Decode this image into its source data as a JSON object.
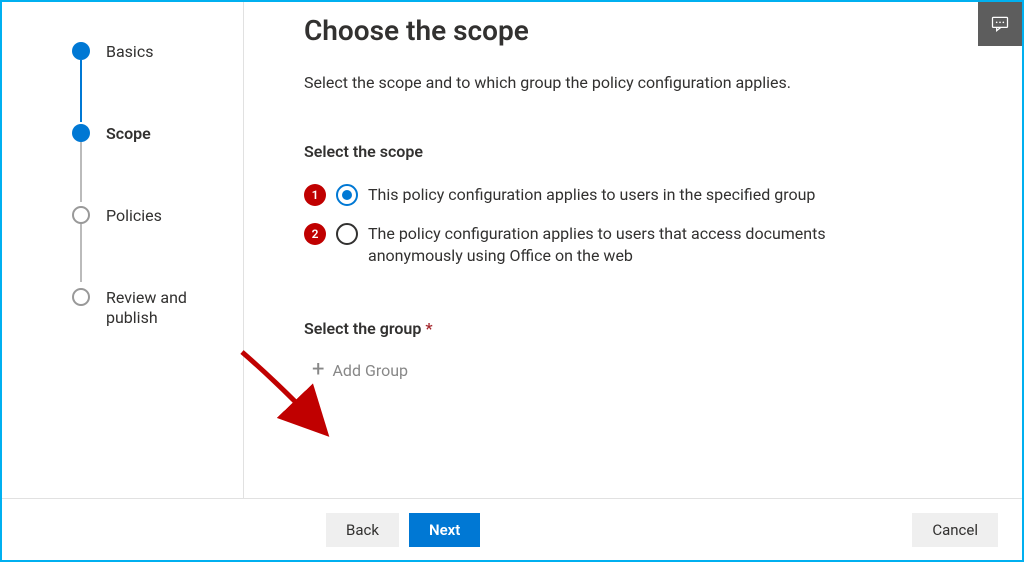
{
  "wizard": {
    "steps": [
      {
        "label": "Basics"
      },
      {
        "label": "Scope"
      },
      {
        "label": "Policies"
      },
      {
        "label": "Review and publish"
      }
    ]
  },
  "page": {
    "title": "Choose the scope",
    "description": "Select the scope and to which group the policy configuration applies."
  },
  "scope_section": {
    "heading": "Select the scope",
    "option1": "This policy configuration applies to users in the specified group",
    "option2": "The policy configuration applies to users that access documents anonymously using Office on the web"
  },
  "group_section": {
    "heading": "Select the group",
    "add_group_label": "Add Group"
  },
  "footer": {
    "back": "Back",
    "next": "Next",
    "cancel": "Cancel"
  },
  "annotations": {
    "badge1": "1",
    "badge2": "2"
  },
  "colors": {
    "primary": "#0078d4",
    "badge": "#c00000",
    "border": "#00b0f0"
  }
}
